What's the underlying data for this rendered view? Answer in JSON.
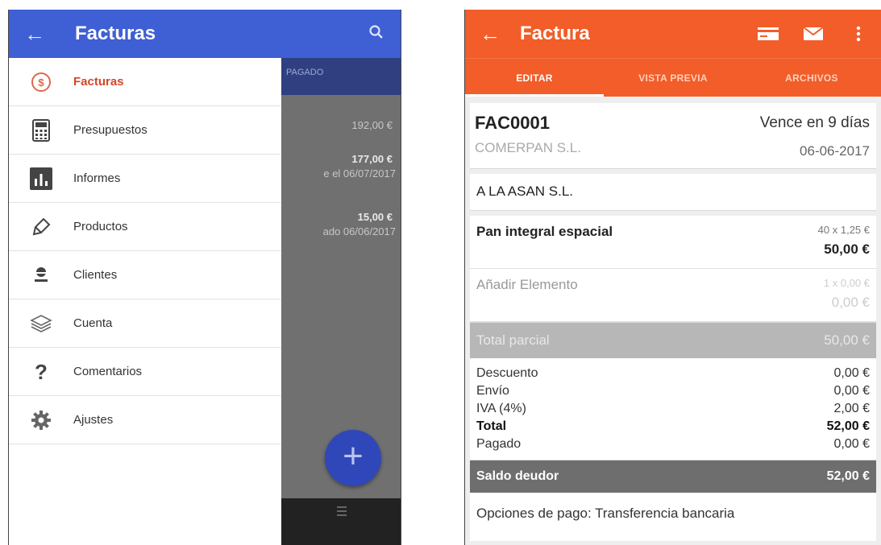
{
  "left": {
    "appbar": {
      "back_icon": "←",
      "title": "Facturas",
      "search_icon": "search-icon"
    },
    "background": {
      "column_header": "PAGADO",
      "amounts": [
        "192,00 €",
        "177,00 €",
        "15,00 €"
      ],
      "subtexts": [
        "e el 06/07/2017",
        "ado 06/06/2017"
      ]
    },
    "drawer": {
      "items": [
        {
          "label": "Facturas",
          "icon": "dollar-circle-icon",
          "active": true
        },
        {
          "label": "Presupuestos",
          "icon": "calculator-icon"
        },
        {
          "label": "Informes",
          "icon": "bar-chart-icon"
        },
        {
          "label": "Productos",
          "icon": "tag-icon"
        },
        {
          "label": "Clientes",
          "icon": "person-icon"
        },
        {
          "label": "Cuenta",
          "icon": "layers-icon"
        },
        {
          "label": "Comentarios",
          "icon": "question-icon"
        },
        {
          "label": "Ajustes",
          "icon": "gear-icon"
        }
      ]
    },
    "fab_icon": "+",
    "colors": {
      "appbar": "#3f5fd4",
      "active": "#d4462a",
      "fab": "#2f47b8"
    }
  },
  "right": {
    "appbar": {
      "back_icon": "←",
      "title": "Factura"
    },
    "tabs": [
      {
        "label": "EDITAR",
        "active": true
      },
      {
        "label": "VISTA PREVIA"
      },
      {
        "label": "ARCHIVOS"
      }
    ],
    "invoice": {
      "number": "FAC0001",
      "due": "Vence en 9 días",
      "client": "COMERPAN S.L.",
      "date": "06-06-2017",
      "recipient": "A  LA ASAN S.L."
    },
    "items": [
      {
        "name": "Pan integral espacial",
        "qty": "40 x 1,25 €",
        "total": "50,00 €"
      },
      {
        "name": "Añadir Elemento",
        "qty": "1 x 0,00 €",
        "total": "0,00 €"
      }
    ],
    "subtotal": {
      "label": "Total parcial",
      "value": "50,00 €"
    },
    "summary": [
      {
        "label": "Descuento",
        "value": "0,00 €"
      },
      {
        "label": "Envío",
        "value": "0,00 €"
      },
      {
        "label": "IVA (4%)",
        "value": "2,00 €"
      },
      {
        "label": "Total",
        "value": "52,00 €"
      },
      {
        "label": "Pagado",
        "value": "0,00 €"
      }
    ],
    "balance": {
      "label": "Saldo deudor",
      "value": "52,00 €"
    },
    "payment": "Opciones de pago: Transferencia bancaria",
    "colors": {
      "appbar": "#f25d29"
    }
  }
}
